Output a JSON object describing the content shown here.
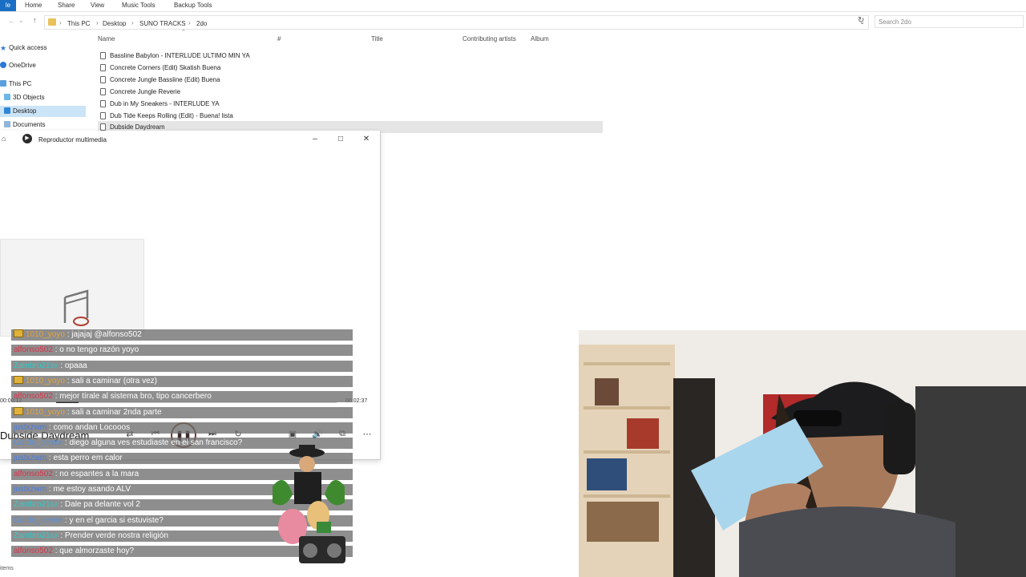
{
  "ribbon": {
    "tabs": [
      "le",
      "Home",
      "Share",
      "View",
      "Music Tools",
      "Backup Tools"
    ]
  },
  "address": {
    "crumbs": [
      "This PC",
      "Desktop",
      "SUNO TRACKS",
      "2do"
    ],
    "search_placeholder": "Search 2do"
  },
  "nav_pane": {
    "items": [
      "Quick access",
      "OneDrive",
      "This PC",
      "3D Objects",
      "Desktop",
      "Documents"
    ]
  },
  "columns": {
    "name": "Name",
    "number": "#",
    "title": "Title",
    "artists": "Contributing artists",
    "album": "Album"
  },
  "files": [
    "Bassline Babylon - INTERLUDE ULTIMO MIN YA",
    "Concrete Corners (Edit) Skatish Buena",
    "Concrete Jungle Bassline (Edit) Buena",
    "Concrete Jungle Reverie",
    "Dub in My Sneakers - INTERLUDE YA",
    "Dub Tide Keeps Rolling (Edit) - Buena! lista",
    "Dubside Daydream"
  ],
  "player": {
    "window_title": "Reproductor multimedia",
    "song_title": "Dubside Daydream",
    "time_current": "00:00:12",
    "time_total": "00:02:37",
    "progress": 0.08
  },
  "chat": [
    {
      "user": "1010_yoyo",
      "msg": "jajajaj @alfonso502",
      "color": "#e8a23a",
      "badge": true
    },
    {
      "user": "alfonso502",
      "msg": "o no tengo razón yoyo",
      "color": "#e0324a",
      "badge": false
    },
    {
      "user": "Zambro21sx",
      "msg": "opaaa",
      "color": "#33c9c9",
      "badge": false
    },
    {
      "user": "1010_yoyo",
      "msg": "sali a caminar (otra vez)",
      "color": "#e8a23a",
      "badge": true
    },
    {
      "user": "alfonso502",
      "msg": "mejor tírale al sistema bro, tipo cancerbero",
      "color": "#e0324a",
      "badge": false
    },
    {
      "user": "1010_yoyo",
      "msg": "sali a caminar 2nda parte",
      "color": "#e8a23a",
      "badge": true
    },
    {
      "user": "justxzwm",
      "msg": "como andan Locooos",
      "color": "#4a7de0",
      "badge": false
    },
    {
      "user": "Gordo_cerote",
      "msg": "diego alguna ves estudiaste en el san francisco?",
      "color": "#5b8fd8",
      "badge": false
    },
    {
      "user": "justxzwm",
      "msg": "esta perro em calor",
      "color": "#4a7de0",
      "badge": false
    },
    {
      "user": "alfonso502",
      "msg": "no espantes a la mara",
      "color": "#e0324a",
      "badge": false
    },
    {
      "user": "justxzwm",
      "msg": "me estoy asando ALV",
      "color": "#4a7de0",
      "badge": false
    },
    {
      "user": "Zambro21sx",
      "msg": "Dale pa delante vol 2",
      "color": "#33c9c9",
      "badge": false
    },
    {
      "user": "Gordo_cerote",
      "msg": "y en el garcia si estuviste?",
      "color": "#5b8fd8",
      "badge": false
    },
    {
      "user": "Zambro21sx",
      "msg": "Prender verde nostra religión",
      "color": "#33c9c9",
      "badge": false
    },
    {
      "user": "alfonso502",
      "msg": "que almorzaste hoy?",
      "color": "#e0324a",
      "badge": false
    }
  ],
  "status": {
    "left_text": "items"
  },
  "colors": {
    "file_tab": "#1a6fc4",
    "selected_row": "#e5e5e5",
    "chat_bg": "#6e6e6e",
    "accent_pause": "#6c3b2a"
  }
}
